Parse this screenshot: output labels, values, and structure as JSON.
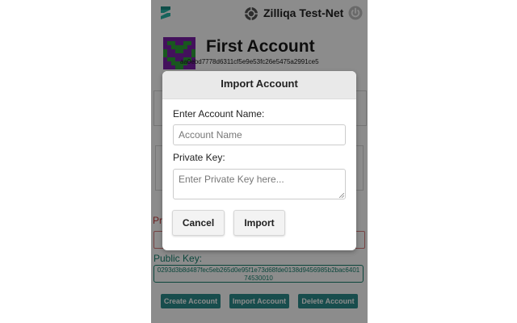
{
  "header": {
    "network_label": "Zilliqa Test-Net",
    "logo_icon": "zilliqa-logo",
    "network_icon": "network-icon",
    "power_icon": "power-icon"
  },
  "account": {
    "name": "First Account",
    "address": "aa0ebd7778d6311cf5e9e53fc26e5475a2991ce5"
  },
  "keys": {
    "private_label": "Pr",
    "public_label": "Public Key:",
    "public_value": "0293d3b8d487fec5eb265d0e95f1e73d68fde0138d9456985b2bac640174530010"
  },
  "actions": {
    "create": "Create Account",
    "import": "Import Account",
    "delete": "Delete Account"
  },
  "modal": {
    "title": "Import Account",
    "name_label": "Enter Account Name:",
    "name_placeholder": "Account Name",
    "key_label": "Private Key:",
    "key_placeholder": "Enter Private Key here...",
    "cancel_label": "Cancel",
    "import_label": "Import"
  },
  "colors": {
    "accent": "#2d8c8c",
    "public_key": "#16806e",
    "error": "#c23b3b",
    "avatar_purple": "#7a1fa8",
    "avatar_green": "#2f9e3a"
  }
}
